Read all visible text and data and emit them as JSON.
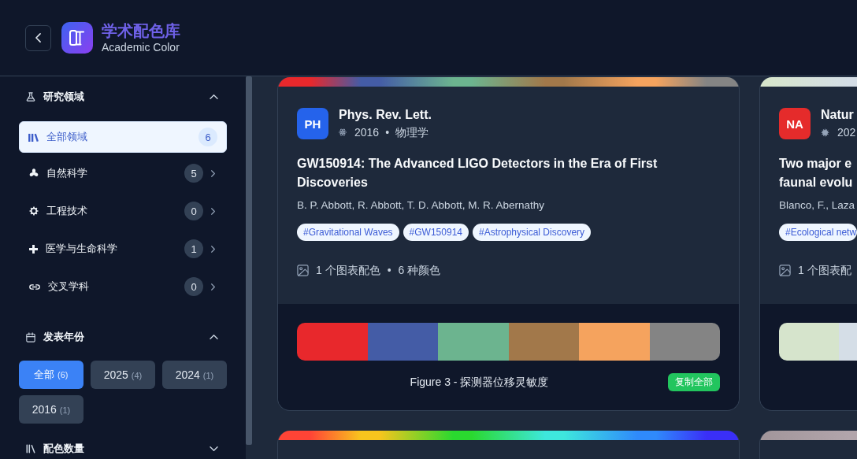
{
  "header": {
    "title": "学术配色库",
    "subtitle": "Academic Color"
  },
  "sidebar": {
    "sections": [
      {
        "kind": "field",
        "title": "研究领域",
        "expanded": true,
        "items": [
          {
            "kind": "all",
            "label": "全部领域",
            "count": "6",
            "selected": true,
            "expandable": false
          },
          {
            "kind": "science",
            "label": "自然科学",
            "count": "5",
            "selected": false,
            "expandable": true
          },
          {
            "kind": "engineering",
            "label": "工程技术",
            "count": "0",
            "selected": false,
            "expandable": true
          },
          {
            "kind": "medicine",
            "label": "医学与生命科学",
            "count": "1",
            "selected": false,
            "expandable": true
          },
          {
            "kind": "cross",
            "label": "交叉学科",
            "count": "0",
            "selected": false,
            "expandable": true
          }
        ]
      },
      {
        "kind": "year",
        "title": "发表年份",
        "expanded": true,
        "chips": [
          {
            "label": "全部",
            "count": "(6)",
            "selected": true
          },
          {
            "label": "2025",
            "count": "(4)",
            "selected": false
          },
          {
            "label": "2024",
            "count": "(1)",
            "selected": false
          },
          {
            "label": "2016",
            "count": "(1)",
            "selected": false
          }
        ]
      },
      {
        "kind": "count",
        "title": "配色数量",
        "expanded": false
      }
    ]
  },
  "cards": [
    {
      "strip": [
        {
          "color": "#e8282c"
        },
        {
          "color": "#445ca6"
        },
        {
          "color": "#6cb48f"
        },
        {
          "color": "#a2784a"
        },
        {
          "color": "#f5a35e"
        },
        {
          "color": "#848484"
        }
      ],
      "avatar": {
        "text": "PH",
        "color": "#2563eb"
      },
      "journal": "Phys. Rev. Lett.",
      "meta": {
        "kind": "physics",
        "year": "2016",
        "separator": "•",
        "field": "物理学"
      },
      "title": "GW150914: The Advanced LIGO Detectors in the Era of First Discoveries",
      "authors": "B. P. Abbott, R. Abbott, T. D. Abbott, M. R. Abernathy",
      "tags": [
        "#Gravitational Waves",
        "#GW150914",
        "#Astrophysical Discovery"
      ],
      "stats": {
        "charts": "1 个图表配色",
        "separator": "•",
        "colors": "6 种颜色"
      },
      "figure": {
        "palette": [
          {
            "color": "#e8282c"
          },
          {
            "color": "#445ca6"
          },
          {
            "color": "#6cb48f"
          },
          {
            "color": "#a2784a"
          },
          {
            "color": "#f5a35e"
          },
          {
            "color": "#848484"
          }
        ],
        "caption": "Figure 3 - 探测器位移灵敏度",
        "button": "复制全部"
      }
    },
    {
      "strip": [
        {
          "color": "#d7e5cc"
        },
        {
          "color": "#d4dde6"
        }
      ],
      "avatar": {
        "text": "NA",
        "color": "#e52b2b"
      },
      "journal": "Natur",
      "meta": {
        "kind": "biology",
        "year": "202"
      },
      "title": "Two major e faunal evolu",
      "authors": "Blanco, F., Laza",
      "tags": [
        "#Ecological netw"
      ],
      "stats": {
        "charts": "1 个图表配"
      },
      "figure": {
        "palette": [
          {
            "color": "#d6e4cc"
          },
          {
            "color": "#d5dee7"
          }
        ]
      }
    },
    {
      "strip": [
        {
          "color": "#ff4436"
        },
        {
          "color": "#f8c51d"
        },
        {
          "color": "#2ad92f"
        },
        {
          "color": "#3ee7dd"
        },
        {
          "color": "#2f8afb"
        },
        {
          "color": "#3a2ff7"
        }
      ]
    },
    {
      "strip": [
        {
          "color": "#a3979c"
        },
        {
          "color": "#b2a5ab"
        }
      ]
    }
  ]
}
